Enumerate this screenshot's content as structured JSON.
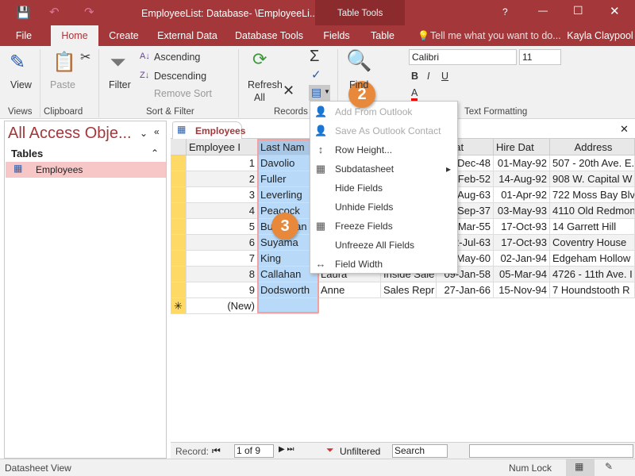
{
  "window": {
    "title": "EmployeeList: Database- \\EmployeeLi...",
    "context_tab_group": "Table Tools",
    "help": "?",
    "user": "Kayla Claypool"
  },
  "tabs": [
    "File",
    "Home",
    "Create",
    "External Data",
    "Database Tools",
    "Fields",
    "Table"
  ],
  "tell_me": "Tell me what you want to do...",
  "ribbon": {
    "views": {
      "view": "View",
      "group": "Views"
    },
    "clipboard": {
      "paste": "Paste",
      "group": "Clipboard"
    },
    "sort_filter": {
      "filter": "Filter",
      "ascending": "Ascending",
      "descending": "Descending",
      "remove_sort": "Remove Sort",
      "group": "Sort & Filter"
    },
    "records": {
      "refresh": "Refresh",
      "all": "All",
      "group": "Records"
    },
    "find": {
      "find": "Find"
    },
    "text_formatting": {
      "font": "Calibri",
      "size": "11",
      "bold": "B",
      "italic": "I",
      "underline": "U",
      "font_color": "A",
      "group": "Text Formatting"
    }
  },
  "callouts": {
    "step2": "2",
    "step3": "3"
  },
  "more_menu": {
    "items": [
      {
        "label": "Add From Outlook",
        "disabled": true,
        "icon": "outlook-contact-icon"
      },
      {
        "label": "Save As Outlook Contact",
        "disabled": true,
        "icon": "save-contact-icon"
      },
      {
        "label": "Row Height...",
        "icon": "row-height-icon"
      },
      {
        "label": "Subdatasheet",
        "icon": "subdatasheet-icon",
        "submenu": true
      },
      {
        "label": "Hide Fields"
      },
      {
        "label": "Unhide Fields"
      },
      {
        "label": "Freeze Fields",
        "icon": "freeze-fields-icon"
      },
      {
        "label": "Unfreeze All Fields"
      },
      {
        "label": "Field Width",
        "icon": "field-width-icon"
      }
    ]
  },
  "nav_pane": {
    "title": "All Access Obje...",
    "section": "Tables",
    "items": [
      "Employees"
    ]
  },
  "datasheet": {
    "tab": "Employees",
    "columns": [
      "Employee I",
      "Last Nam",
      "",
      "",
      "n Dat",
      "Hire Dat",
      "Address"
    ],
    "rows": [
      [
        "1",
        "Davolio",
        "",
        "",
        "Dec-48",
        "01-May-92",
        "507 - 20th Ave. E."
      ],
      [
        "2",
        "Fuller",
        "",
        "",
        "Feb-52",
        "14-Aug-92",
        "908 W. Capital W"
      ],
      [
        "3",
        "Leverling",
        "",
        "",
        "Aug-63",
        "01-Apr-92",
        "722 Moss Bay Blv"
      ],
      [
        "4",
        "Peacock",
        "",
        "",
        "Sep-37",
        "03-May-93",
        "4110 Old Redmon"
      ],
      [
        "5",
        "Buchanan",
        "",
        "",
        "Mar-55",
        "17-Oct-93",
        "14 Garrett Hill"
      ],
      [
        "6",
        "Suyama",
        "",
        "",
        "2-Jul-63",
        "17-Oct-93",
        "Coventry House"
      ],
      [
        "7",
        "King",
        "",
        "",
        "May-60",
        "02-Jan-94",
        "Edgeham Hollow"
      ],
      [
        "8",
        "Callahan",
        "Laura",
        "Inside Sale",
        "09-Jan-58",
        "05-Mar-94",
        "4726 - 11th Ave. I"
      ],
      [
        "9",
        "Dodsworth",
        "Anne",
        "Sales Repr",
        "27-Jan-66",
        "15-Nov-94",
        "7 Houndstooth R"
      ]
    ],
    "new_row": "(New)"
  },
  "record_nav": {
    "label": "Record:",
    "position": "1 of 9",
    "filter": "Unfiltered",
    "search": "Search"
  },
  "status": {
    "view": "Datasheet View",
    "num_lock": "Num Lock"
  },
  "colors": {
    "accent": "#a4373a",
    "callout": "#e8883a",
    "selected": "#b8d9f7"
  }
}
